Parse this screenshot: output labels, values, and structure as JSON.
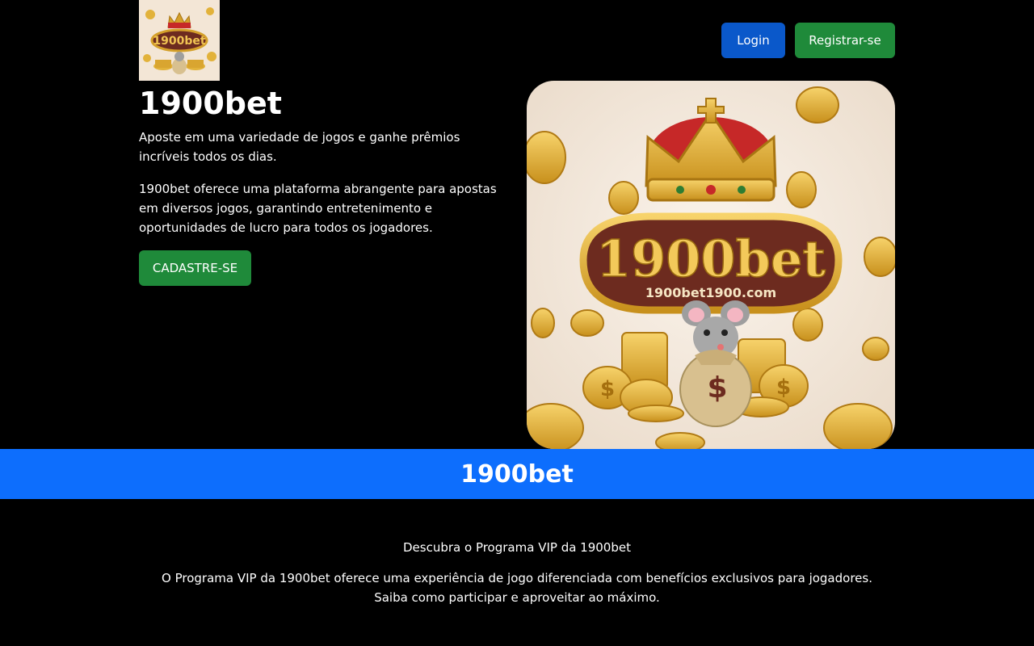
{
  "header": {
    "logo_alt": "1900bet",
    "logo_small_text": "1900bet1900.com",
    "login_label": "Login",
    "register_label": "Registrar-se"
  },
  "hero": {
    "title": "1900bet",
    "paragraph1": "Aposte em uma variedade de jogos e ganhe prêmios incríveis todos os dias.",
    "paragraph2": "1900bet oferece uma plataforma abrangente para apostas em diversos jogos, garantindo entretenimento e oportunidades de lucro para todos os jogadores.",
    "cta_label": "CADASTRE-SE",
    "image_brand": "1900bet",
    "image_url_text": "1900bet1900.com",
    "image_currency_symbol": "$"
  },
  "banner": {
    "title": "1900bet"
  },
  "vip": {
    "heading": "Descubra o Programa VIP da 1900bet",
    "text": "O Programa VIP da 1900bet oferece uma experiência de jogo diferenciada com benefícios exclusivos para jogadores. Saiba como participar e aproveitar ao máximo."
  },
  "colors": {
    "background": "#000000",
    "login_button": "#0a58ca",
    "register_button": "#1f8a3a",
    "banner": "#0d6efd",
    "text": "#ffffff"
  }
}
